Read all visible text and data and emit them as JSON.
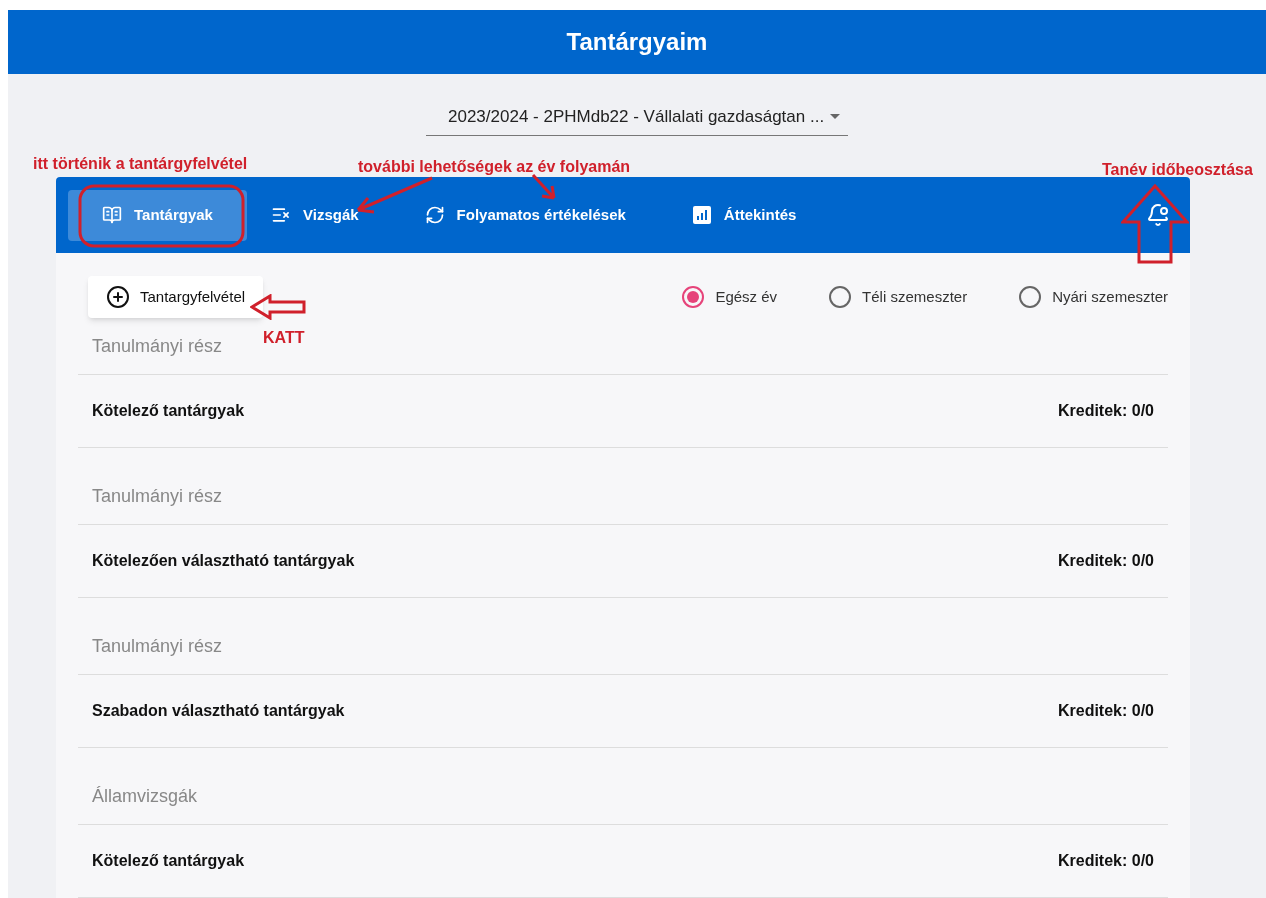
{
  "header": {
    "title": "Tantárgyaim"
  },
  "term_select": {
    "value": "2023/2024 - 2PHMdb22 - Vállalati gazdaságtan ..."
  },
  "tabs": [
    {
      "label": "Tantárgyak",
      "kind": "book",
      "selected": true
    },
    {
      "label": "Vizsgák",
      "kind": "exam",
      "selected": false
    },
    {
      "label": "Folyamatos értékelések",
      "kind": "sync",
      "selected": false
    },
    {
      "label": "Áttekintés",
      "kind": "chart",
      "selected": false
    }
  ],
  "add_button": {
    "label": "Tantargyfelvétel"
  },
  "period_filter": [
    {
      "label": "Egész év",
      "selected": true
    },
    {
      "label": "Téli szemeszter",
      "selected": false
    },
    {
      "label": "Nyári szemeszter",
      "selected": false
    }
  ],
  "sections": [
    {
      "heading": "Tanulmányi rész",
      "title": "Kötelező tantárgyak",
      "credits": "Kreditek: 0/0"
    },
    {
      "heading": "Tanulmányi rész",
      "title": "Kötelezően választható tantárgyak",
      "credits": "Kreditek: 0/0"
    },
    {
      "heading": "Tanulmányi rész",
      "title": "Szabadon választható tantárgyak",
      "credits": "Kreditek: 0/0"
    },
    {
      "heading": "Államvizsgák",
      "title": "Kötelező tantárgyak",
      "credits": "Kreditek: 0/0"
    }
  ],
  "annotations": [
    "itt történik a tantárgyfelvétel",
    "további lehetőségek az év folyamán",
    "Tanév időbeosztása",
    "KATT"
  ]
}
